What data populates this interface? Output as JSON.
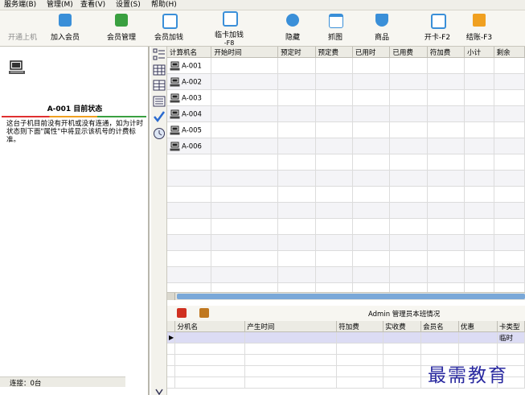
{
  "menu": [
    "服务端(B)",
    "管理(M)",
    "查看(V)",
    "设置(S)",
    "帮助(H)"
  ],
  "toolbar": {
    "items": [
      {
        "label": "开通上机",
        "color": "",
        "disabled": true
      },
      {
        "label": "加入会员",
        "color": "#3a8fd8",
        "disabled": false
      },
      {
        "label": "会员管理",
        "color": "#3aa040",
        "disabled": false
      },
      {
        "label": "会员加钱",
        "color": "#3a8fd8",
        "disabled": false
      },
      {
        "label": "临卡加钱",
        "label2": "-F8",
        "color": "#3a8fd8",
        "disabled": false
      },
      {
        "label": "隐藏",
        "color": "#3a8fd8",
        "disabled": false
      },
      {
        "label": "抓图",
        "color": "#3a8fd8",
        "disabled": false
      },
      {
        "label": "商品",
        "color": "#3a8fd8",
        "disabled": false
      },
      {
        "label": "开卡-F2",
        "color": "#3a8fd8",
        "disabled": false
      },
      {
        "label": "结账-F3",
        "color": "#f0a020",
        "disabled": false
      }
    ]
  },
  "left_panel": {
    "title": "A-001 目前状态",
    "description": "这台子机目前没有开机或没有连通，如为计时状态则下面\"属性\"中将显示该机号的计费标准。",
    "status": "连接：0台"
  },
  "grid": {
    "columns": [
      "计算机名",
      "开始时间",
      "预定时",
      "预定费",
      "已用时",
      "已用费",
      "符加费",
      "小计",
      "剩余"
    ],
    "rows": [
      "A-001",
      "A-002",
      "A-003",
      "A-004",
      "A-005",
      "A-006"
    ]
  },
  "bottom": {
    "title": "Admin 管理员本班情况",
    "columns": [
      "分机名",
      "产生时间",
      "符加费",
      "实收费",
      "会员名",
      "优惠",
      "卡类型"
    ],
    "row": {
      "card_type": "临时"
    }
  },
  "watermark": "最需教育",
  "colors": {
    "accent": "#3a8fd8",
    "toolbar_bg": "#f7f6f1"
  }
}
